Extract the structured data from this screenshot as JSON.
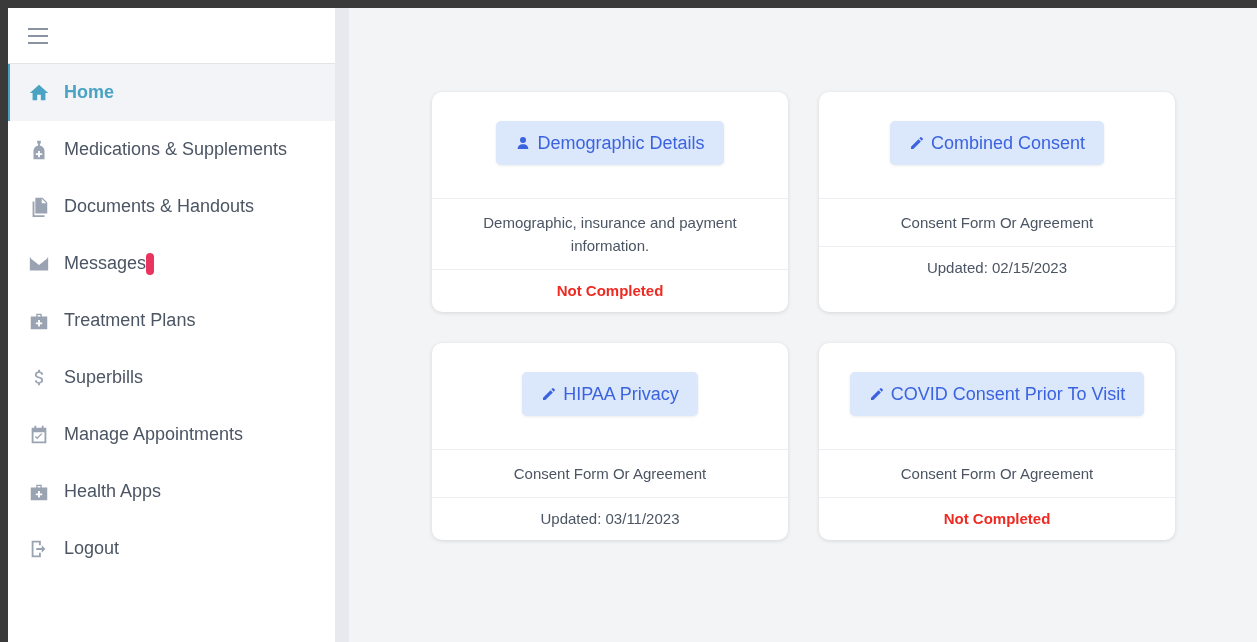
{
  "sidebar": {
    "items": [
      {
        "label": "Home",
        "kind": "home",
        "selected": true,
        "unread": false
      },
      {
        "label": "Medications & Supplements",
        "kind": "medications",
        "selected": false,
        "unread": false
      },
      {
        "label": "Documents & Handouts",
        "kind": "documents",
        "selected": false,
        "unread": false
      },
      {
        "label": "Messages",
        "kind": "messages",
        "selected": false,
        "unread": true
      },
      {
        "label": "Treatment Plans",
        "kind": "plans",
        "selected": false,
        "unread": false
      },
      {
        "label": "Superbills",
        "kind": "billing",
        "selected": false,
        "unread": false
      },
      {
        "label": "Manage Appointments",
        "kind": "appointments",
        "selected": false,
        "unread": false
      },
      {
        "label": "Health Apps",
        "kind": "apps",
        "selected": false,
        "unread": false
      },
      {
        "label": "Logout",
        "kind": "logout",
        "selected": false,
        "unread": false
      }
    ]
  },
  "cards": [
    {
      "button": "Demographic Details",
      "kind": "profile",
      "description": "Demographic, insurance and payment information.",
      "status": {
        "kind": "not_completed",
        "text": "Not Completed"
      }
    },
    {
      "button": "Combined Consent",
      "kind": "form",
      "description": "Consent Form Or Agreement",
      "status": {
        "kind": "updated",
        "text": "Updated: 02/15/2023"
      }
    },
    {
      "button": "HIPAA Privacy",
      "kind": "form",
      "description": "Consent Form Or Agreement",
      "status": {
        "kind": "updated",
        "text": "Updated: 03/11/2023"
      }
    },
    {
      "button": "COVID Consent Prior To Visit",
      "kind": "form",
      "description": "Consent Form Or Agreement",
      "status": {
        "kind": "not_completed",
        "text": "Not Completed"
      }
    }
  ]
}
